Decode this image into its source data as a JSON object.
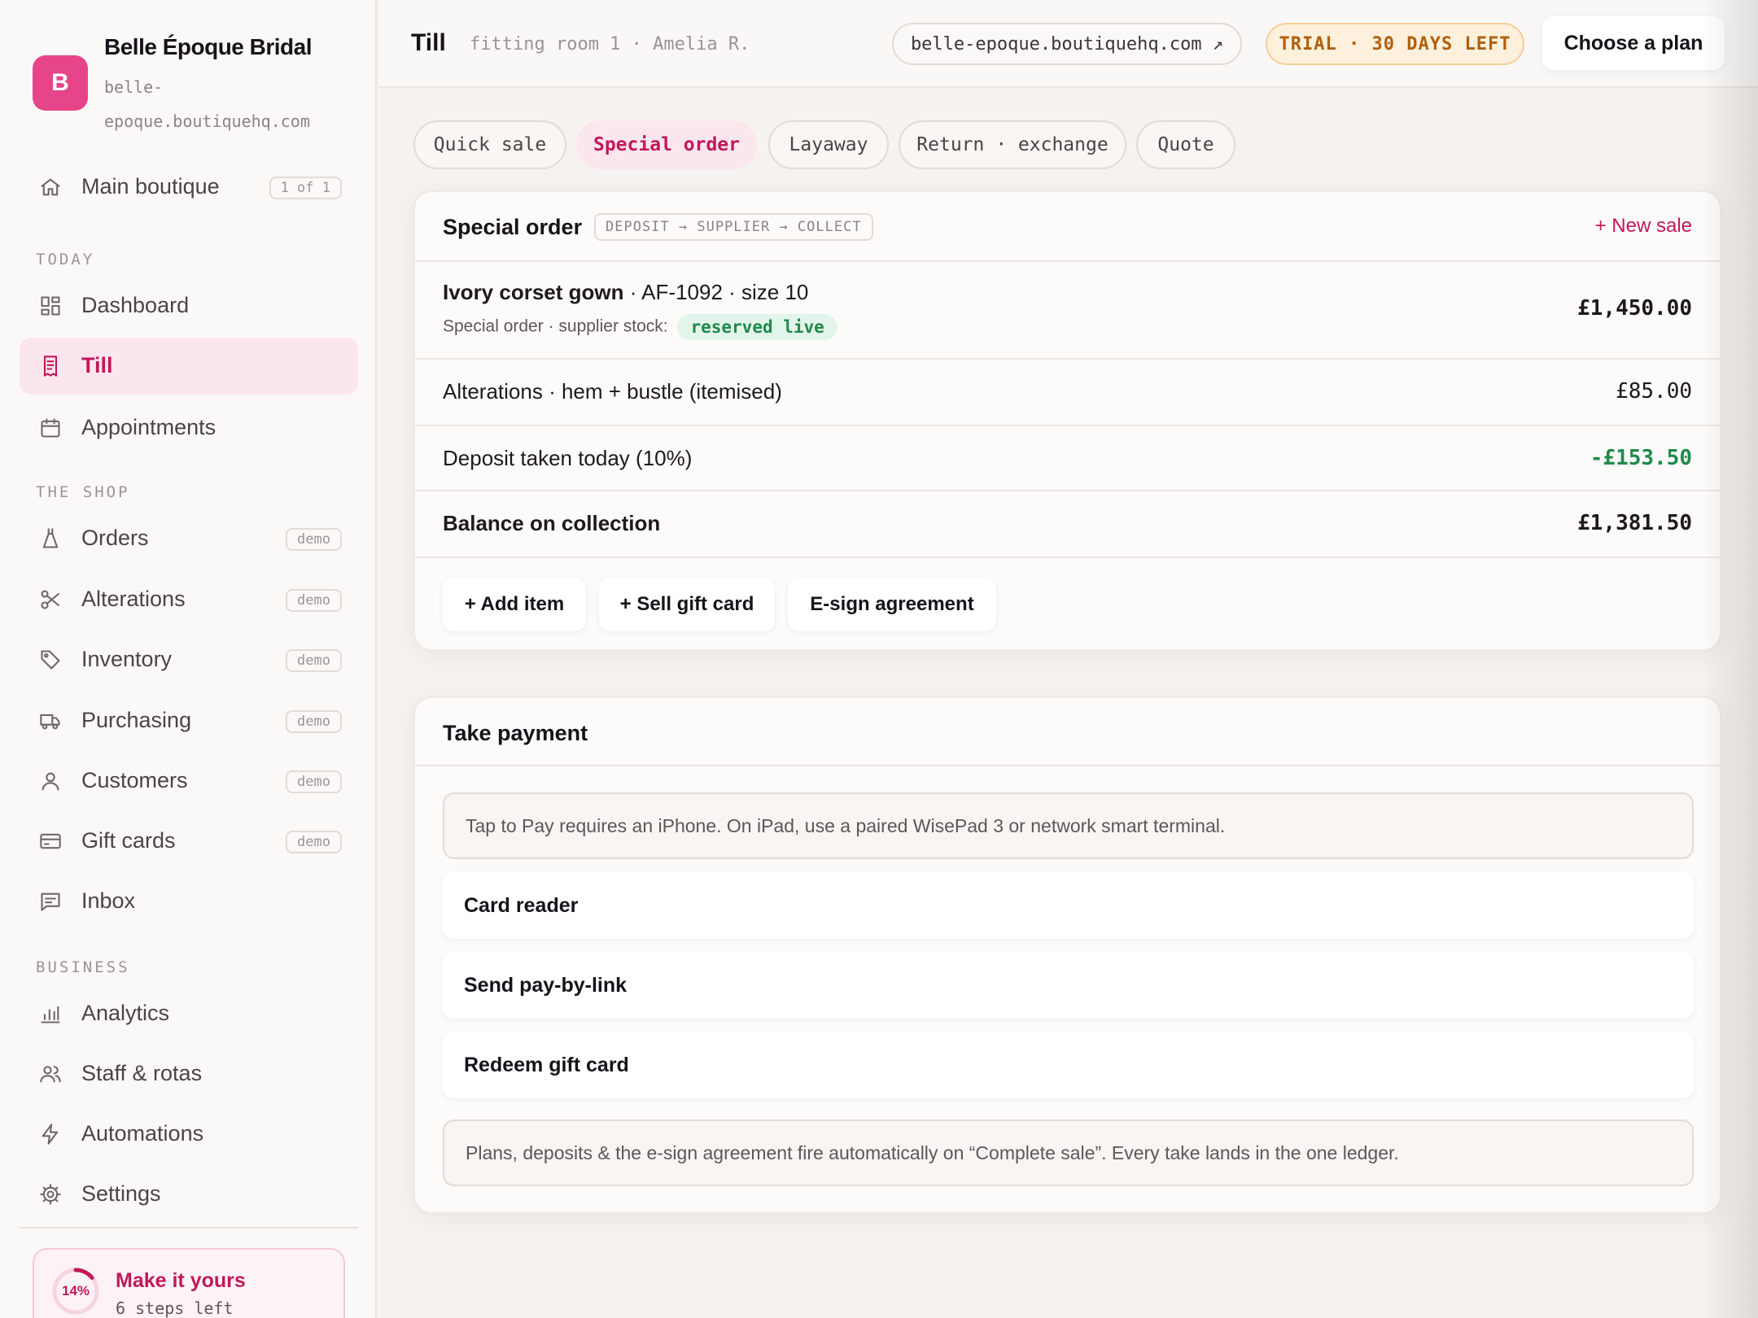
{
  "brand": {
    "initial": "B",
    "name": "Belle Époque Bridal",
    "domain": "belle-epoque.boutiquehq.com"
  },
  "store_switcher": {
    "label": "Main boutique",
    "count": "1 of 1",
    "icon": "home-icon"
  },
  "sections": {
    "today": "TODAY",
    "shop": "THE SHOP",
    "business": "BUSINESS"
  },
  "nav": {
    "dashboard": {
      "label": "Dashboard",
      "icon": "grid-icon"
    },
    "till": {
      "label": "Till",
      "icon": "receipt-icon"
    },
    "appointments": {
      "label": "Appointments",
      "icon": "calendar-icon"
    },
    "orders": {
      "label": "Orders",
      "badge": "demo",
      "icon": "dress-icon"
    },
    "alterations": {
      "label": "Alterations",
      "badge": "demo",
      "icon": "scissors-icon"
    },
    "inventory": {
      "label": "Inventory",
      "badge": "demo",
      "icon": "tag-icon"
    },
    "purchasing": {
      "label": "Purchasing",
      "badge": "demo",
      "icon": "truck-icon"
    },
    "customers": {
      "label": "Customers",
      "badge": "demo",
      "icon": "user-icon"
    },
    "gift_cards": {
      "label": "Gift cards",
      "badge": "demo",
      "icon": "card-icon"
    },
    "inbox": {
      "label": "Inbox",
      "icon": "message-icon"
    },
    "analytics": {
      "label": "Analytics",
      "icon": "bar-chart-icon"
    },
    "staff": {
      "label": "Staff & rotas",
      "icon": "users-icon"
    },
    "automations": {
      "label": "Automations",
      "icon": "bolt-icon"
    },
    "settings": {
      "label": "Settings",
      "icon": "gear-icon"
    }
  },
  "onboarding": {
    "percent_label": "14%",
    "progress": 0.14,
    "title": "Make it yours",
    "subtitle": "6 steps left"
  },
  "topbar": {
    "title": "Till",
    "context": "fitting room 1 · Amelia R.",
    "domain_link": "belle-epoque.boutiquehq.com ↗",
    "trial": "TRIAL · 30 DAYS LEFT",
    "plan_button": "Choose a plan"
  },
  "modes": [
    "Quick sale",
    "Special order",
    "Layaway",
    "Return · exchange",
    "Quote"
  ],
  "active_mode": "Special order",
  "order": {
    "title": "Special order",
    "flow": "DEPOSIT → SUPPLIER → COLLECT",
    "new_sale": "+ New sale",
    "item": {
      "name": "Ivory corset gown",
      "detail": "· AF-1092 · size 10",
      "sub": "Special order · supplier stock:",
      "status": "reserved live",
      "price": "£1,450.00"
    },
    "alterations": {
      "label": "Alterations · hem + bustle (itemised)",
      "price": "£85.00"
    },
    "deposit": {
      "label": "Deposit taken today (10%)",
      "price": "-£153.50"
    },
    "balance": {
      "label": "Balance on collection",
      "price": "£1,381.50"
    },
    "actions": [
      "+ Add item",
      "+ Sell gift card",
      "E-sign agreement"
    ]
  },
  "payment": {
    "title": "Take payment",
    "notice": "Tap to Pay requires an iPhone. On iPad, use a paired WisePad 3 or network smart terminal.",
    "options": [
      "Card reader",
      "Send pay-by-link",
      "Redeem gift card"
    ],
    "footnote": "Plans, deposits & the e-sign agreement fire automatically on “Complete sale”. Every take lands in the one ledger."
  },
  "colors": {
    "accent": "#c2185b",
    "logo": "#e6458a",
    "positive": "#1f8a4c",
    "trial": "#b0600c"
  }
}
